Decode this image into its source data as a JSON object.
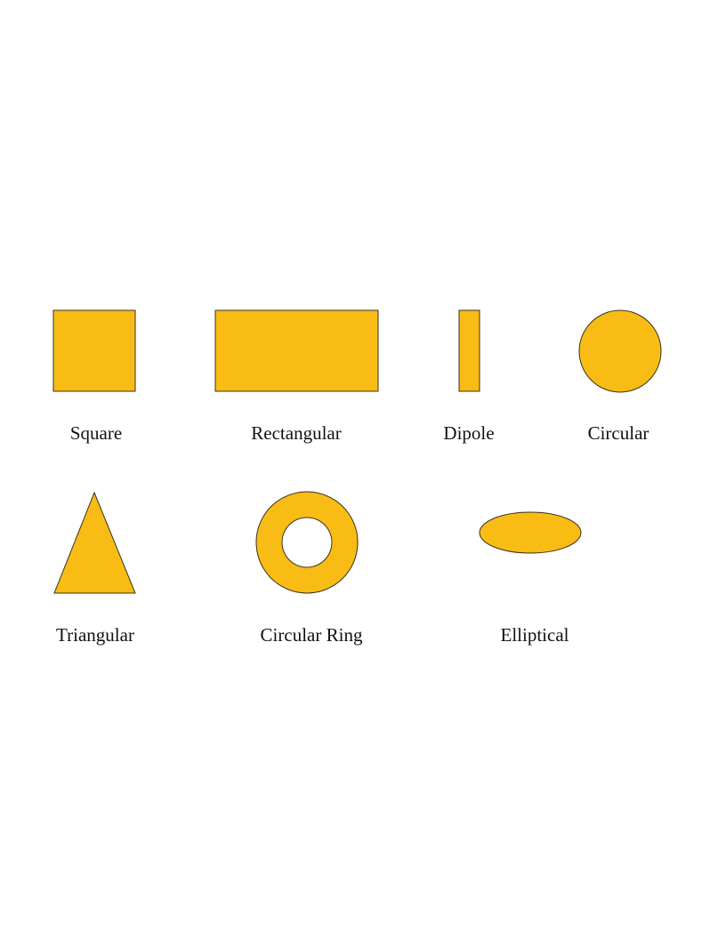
{
  "colors": {
    "shape_fill": "#F9BC15",
    "shape_stroke": "#3a3020",
    "label_text": "#111111",
    "background": "#ffffff"
  },
  "shapes": [
    {
      "id": "square",
      "label": "Square"
    },
    {
      "id": "rectangular",
      "label": "Rectangular"
    },
    {
      "id": "dipole",
      "label": "Dipole"
    },
    {
      "id": "circular",
      "label": "Circular"
    },
    {
      "id": "triangular",
      "label": "Triangular"
    },
    {
      "id": "circular-ring",
      "label": "Circular Ring"
    },
    {
      "id": "elliptical",
      "label": "Elliptical"
    }
  ]
}
